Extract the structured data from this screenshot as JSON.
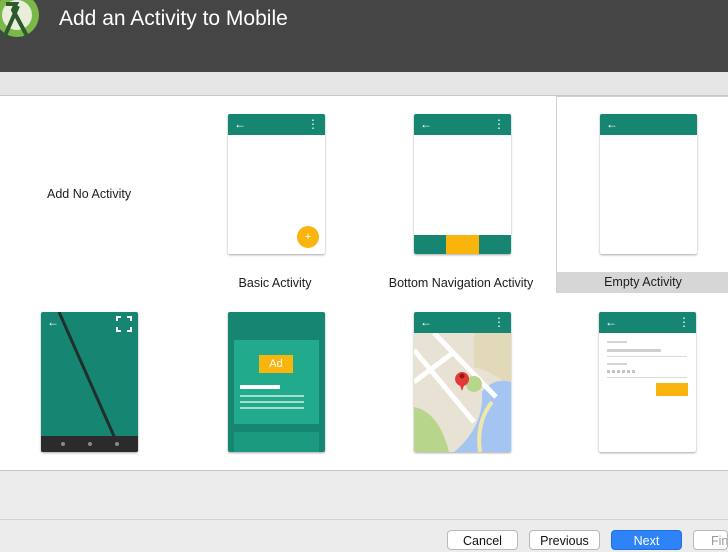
{
  "window": {
    "title": "Add an Activity to Mobile"
  },
  "templates": [
    {
      "label": "Add No Activity"
    },
    {
      "label": "Basic Activity",
      "fab_glyph": "+"
    },
    {
      "label": "Bottom Navigation Activity"
    },
    {
      "label": "Empty Activity",
      "selected": true
    },
    {
      "label": ""
    },
    {
      "label": "",
      "ad_badge": "Ad"
    },
    {
      "label": ""
    },
    {
      "label": ""
    }
  ],
  "icons": {
    "back": "←",
    "overflow": "⋮"
  },
  "buttons": {
    "cancel": "Cancel",
    "previous": "Previous",
    "next": "Next",
    "finish": "Finish"
  },
  "colors": {
    "header": "#454545",
    "teal": "#168672",
    "amber": "#f9b50e",
    "primary": "#2d83f7"
  }
}
